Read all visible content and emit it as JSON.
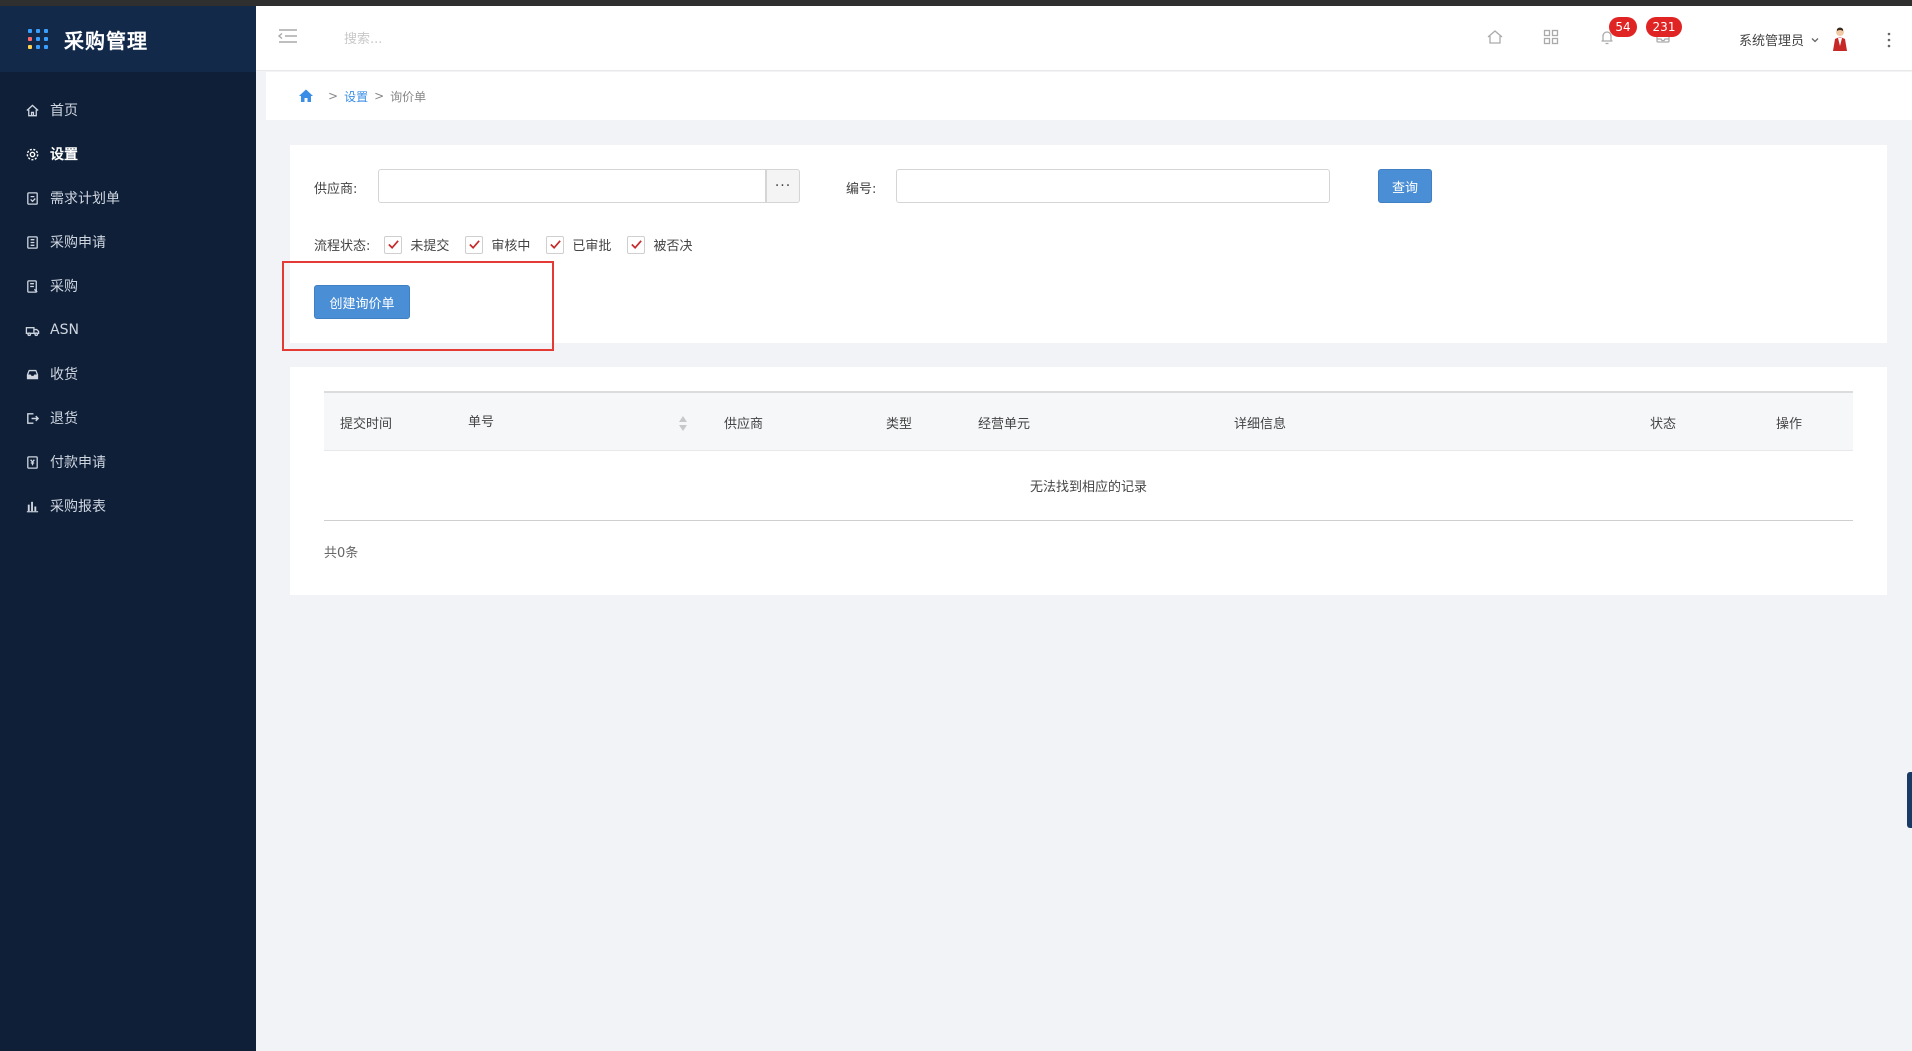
{
  "app": {
    "title": "采购管理"
  },
  "sidebar": {
    "items": [
      {
        "label": "首页",
        "icon": "home-icon"
      },
      {
        "label": "设置",
        "icon": "gear-icon",
        "active": true
      },
      {
        "label": "需求计划单",
        "icon": "plan-doc-icon"
      },
      {
        "label": "采购申请",
        "icon": "request-doc-icon"
      },
      {
        "label": "采购",
        "icon": "purchase-doc-icon"
      },
      {
        "label": "ASN",
        "icon": "truck-icon"
      },
      {
        "label": "收货",
        "icon": "inbox-icon"
      },
      {
        "label": "退货",
        "icon": "return-icon"
      },
      {
        "label": "付款申请",
        "icon": "payment-icon"
      },
      {
        "label": "采购报表",
        "icon": "bar-chart-icon"
      }
    ]
  },
  "header": {
    "search_placeholder": "搜索...",
    "notifications_count": "54",
    "messages_count": "231",
    "user_name": "系统管理员"
  },
  "breadcrumb": {
    "items": [
      "设置",
      "询价单"
    ]
  },
  "filter": {
    "supplier_label": "供应商:",
    "supplier_value": "",
    "ellipsis": "···",
    "code_label": "编号:",
    "code_value": "",
    "query_button": "查询",
    "status_label": "流程状态:",
    "statuses": [
      {
        "label": "未提交",
        "checked": true
      },
      {
        "label": "审核中",
        "checked": true
      },
      {
        "label": "已审批",
        "checked": true
      },
      {
        "label": "被否决",
        "checked": true
      }
    ],
    "create_button": "创建询价单"
  },
  "table": {
    "columns": [
      "提交时间",
      "单号",
      "供应商",
      "类型",
      "经营单元",
      "详细信息",
      "状态",
      "操作"
    ],
    "empty_text": "无法找到相应的记录",
    "total_text": "共0条"
  },
  "colors": {
    "sidebar_bg": "#0f1f38",
    "brand_bg": "#12294a",
    "primary": "#4a8fd6",
    "badge": "#e02424",
    "highlight": "#e53935",
    "check": "#c62828"
  }
}
